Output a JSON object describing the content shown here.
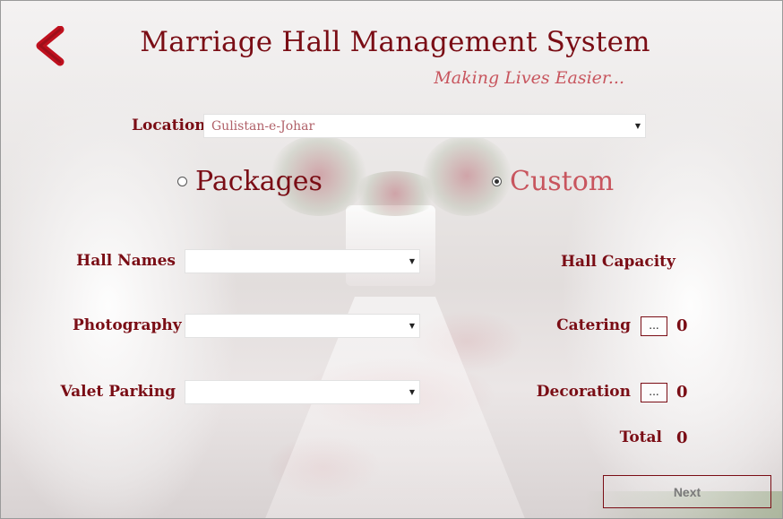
{
  "app": {
    "title": "Marriage Hall Management System",
    "subtitle": "Making Lives Easier...",
    "accent_color": "#7a0d15",
    "subtitle_color": "#c8555e"
  },
  "back_button": {
    "icon": "chevron-left-icon",
    "color": "#c0101e"
  },
  "location": {
    "label": "Location",
    "value": "Gulistan-e-Johar"
  },
  "mode": {
    "packages_label": "Packages",
    "custom_label": "Custom",
    "selected": "Custom"
  },
  "form": {
    "hall_names_label": "Hall Names",
    "hall_names_value": "",
    "photography_label": "Photography",
    "photography_value": "",
    "valet_parking_label": "Valet Parking",
    "valet_parking_value": ""
  },
  "summary": {
    "hall_capacity_label": "Hall Capacity",
    "catering_label": "Catering",
    "catering_button": "...",
    "catering_value": "0",
    "decoration_label": "Decoration",
    "decoration_button": "...",
    "decoration_value": "0",
    "total_label": "Total",
    "total_value": "0"
  },
  "next_button": "Next"
}
